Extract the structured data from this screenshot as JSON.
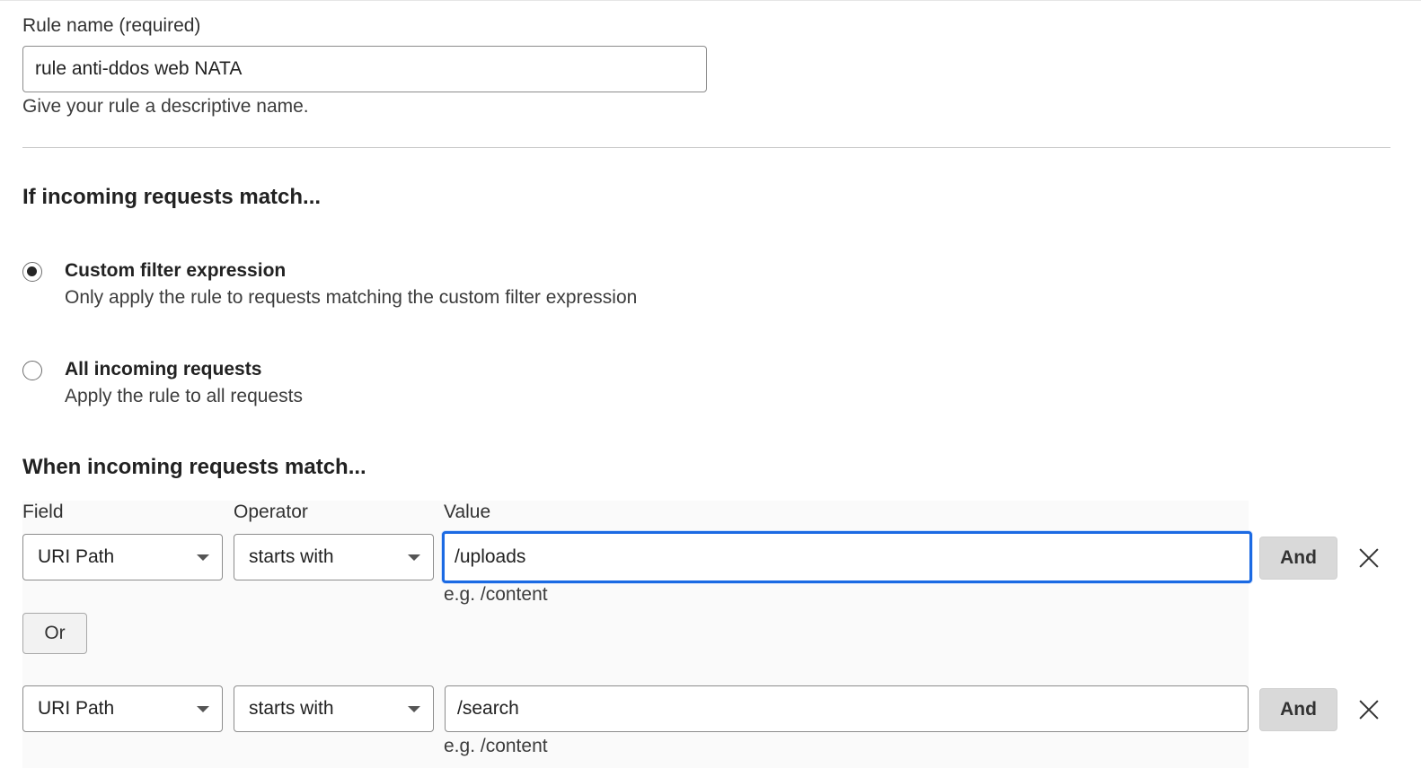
{
  "rule_name": {
    "label": "Rule name (required)",
    "value": "rule anti-ddos web NATA",
    "help": "Give your rule a descriptive name."
  },
  "match_section": {
    "title": "If incoming requests match...",
    "options": [
      {
        "title": "Custom filter expression",
        "description": "Only apply the rule to requests matching the custom filter expression",
        "selected": true
      },
      {
        "title": "All incoming requests",
        "description": "Apply the rule to all requests",
        "selected": false
      }
    ]
  },
  "builder": {
    "title": "When incoming requests match...",
    "columns": {
      "field": "Field",
      "operator": "Operator",
      "value": "Value"
    },
    "rows": [
      {
        "field": "URI Path",
        "operator": "starts with",
        "value": "/uploads",
        "example": "e.g. /content",
        "and_label": "And"
      },
      {
        "field": "URI Path",
        "operator": "starts with",
        "value": "/search",
        "example": "e.g. /content",
        "and_label": "And"
      }
    ],
    "or_label": "Or"
  },
  "colors": {
    "focus": "#1b6ae3",
    "and_button": "#d9d9d9"
  },
  "icons": {
    "remove": "close-icon",
    "dropdown": "chevron-down-icon"
  }
}
